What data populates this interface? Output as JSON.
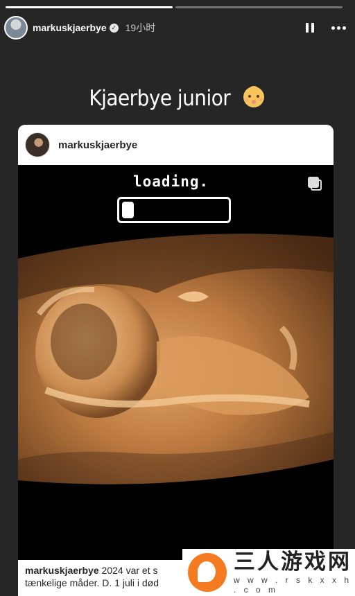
{
  "story": {
    "progress": [
      1.0,
      0.0
    ]
  },
  "header": {
    "username": "markuskjaerbye",
    "verified_icon": "verified-check-icon",
    "time": "19小时",
    "pause_icon": "pause-icon",
    "more_icon": "more-dots-icon"
  },
  "caption": {
    "text": "Kjaerbye junior",
    "emoji_icon": "baby-face-icon"
  },
  "shared_post": {
    "username": "markuskjaerbye",
    "loading_text": "loading.",
    "loading_progress": 0.08,
    "carousel_icon": "multiple-posts-icon",
    "caption_user": "markuskjaerbye",
    "caption_line1": "2024 var et s",
    "caption_line2": "tænkelige måder. D. 1 juli i død"
  },
  "watermark": {
    "title": "三人游戏网",
    "subtitle": "w w w . r s k x x h . c o m"
  },
  "colors": {
    "background": "#262626",
    "scan_tone": "#c98a4f",
    "watermark_accent": "#f47b20"
  }
}
